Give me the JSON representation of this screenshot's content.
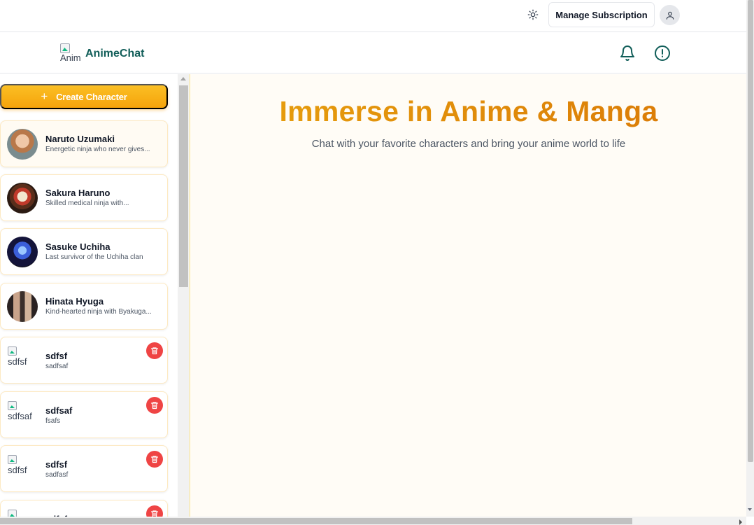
{
  "topbar": {
    "manage_label": "Manage Subscription",
    "theme_icon": "sun-icon",
    "user_icon": "user-icon"
  },
  "header": {
    "logo_alt": "Anim",
    "brand": "AnimeChat",
    "bell_icon": "bell-icon",
    "info_icon": "alert-circle-icon"
  },
  "sidebar": {
    "create_label": "Create Character",
    "create_icon": "plus-icon",
    "characters": [
      {
        "name": "Naruto Uzumaki",
        "desc": "Energetic ninja who never gives..."
      },
      {
        "name": "Sakura Haruno",
        "desc": "Skilled medical ninja with..."
      },
      {
        "name": "Sasuke Uchiha",
        "desc": "Last survivor of the Uchiha clan"
      },
      {
        "name": "Hinata Hyuga",
        "desc": "Kind-hearted ninja with Byakuga..."
      }
    ],
    "custom_characters": [
      {
        "alt": "sdfsf",
        "name": "sdfsf",
        "desc": "sadfsaf"
      },
      {
        "alt": "sdfsaf",
        "name": "sdfsaf",
        "desc": "fsafs"
      },
      {
        "alt": "sdfsf",
        "name": "sdfsf",
        "desc": "sadfasf"
      },
      {
        "alt": "sdfsf",
        "name": "sdfsf",
        "desc": ""
      }
    ],
    "delete_icon": "trash-icon"
  },
  "main": {
    "title": "Immerse in Anime & Manga",
    "subtitle": "Chat with your favorite characters and bring your anime world to life"
  },
  "colors": {
    "accent": "#f59e0b",
    "brand": "#115e59",
    "danger": "#ef4444"
  }
}
